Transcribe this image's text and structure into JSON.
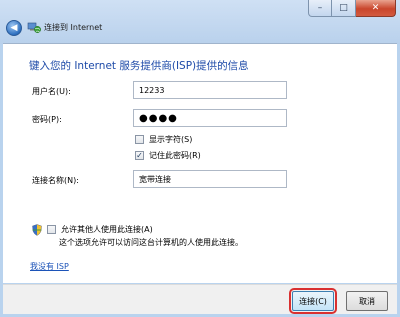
{
  "window": {
    "title": "连接到 Internet",
    "minimize": "–",
    "maximize": "□",
    "close": "✕",
    "back": "◀"
  },
  "form": {
    "heading": "键入您的 Internet 服务提供商(ISP)提供的信息",
    "username_label": "用户名(U):",
    "username_value": "12233",
    "password_label": "密码(P):",
    "password_value": "●●●●",
    "show_chars_label": "显示字符(S)",
    "show_chars_checked": false,
    "remember_label": "记住此密码(R)",
    "remember_checked": true,
    "connection_name_label": "连接名称(N):",
    "connection_name_value": "宽带连接",
    "allow_others_label": "允许其他人使用此连接(A)",
    "allow_others_checked": false,
    "allow_others_note": "这个选项允许可以访问这台计算机的人使用此连接。",
    "no_isp_link": "我没有 ISP"
  },
  "buttons": {
    "connect": "连接(C)",
    "cancel": "取消"
  },
  "checkmark": "✓"
}
